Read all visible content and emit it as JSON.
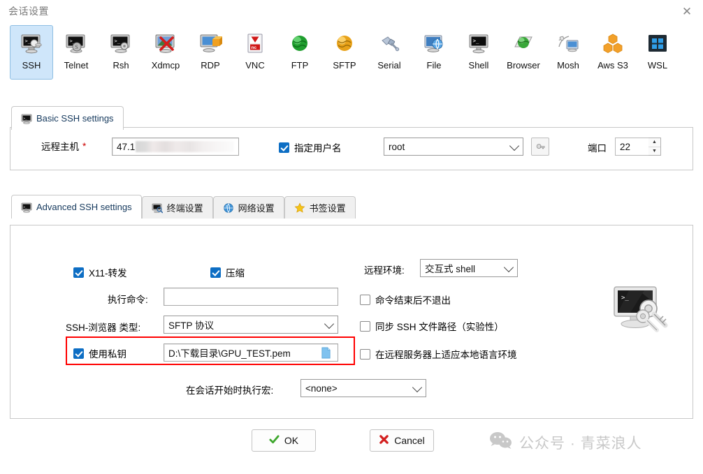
{
  "window": {
    "title": "会话设置",
    "close_label": "✕"
  },
  "protocols": [
    {
      "label": "SSH",
      "icon": "ssh-terminal-icon",
      "selected": true
    },
    {
      "label": "Telnet",
      "icon": "telnet-icon",
      "selected": false
    },
    {
      "label": "Rsh",
      "icon": "rsh-icon",
      "selected": false
    },
    {
      "label": "Xdmcp",
      "icon": "xdmcp-icon",
      "selected": false
    },
    {
      "label": "RDP",
      "icon": "rdp-icon",
      "selected": false
    },
    {
      "label": "VNC",
      "icon": "vnc-icon",
      "selected": false
    },
    {
      "label": "FTP",
      "icon": "ftp-globe-icon",
      "selected": false
    },
    {
      "label": "SFTP",
      "icon": "sftp-globe-icon",
      "selected": false
    },
    {
      "label": "Serial",
      "icon": "serial-plug-icon",
      "selected": false
    },
    {
      "label": "File",
      "icon": "file-share-icon",
      "selected": false
    },
    {
      "label": "Shell",
      "icon": "shell-monitor-icon",
      "selected": false
    },
    {
      "label": "Browser",
      "icon": "browser-globe-icon",
      "selected": false
    },
    {
      "label": "Mosh",
      "icon": "mosh-icon",
      "selected": false
    },
    {
      "label": "Aws S3",
      "icon": "aws-s3-icon",
      "selected": false
    },
    {
      "label": "WSL",
      "icon": "wsl-windows-icon",
      "selected": false
    }
  ],
  "basic": {
    "tab_label": "Basic SSH settings",
    "host_label": "远程主机",
    "host_required_mark": "*",
    "host_value": "47.1",
    "specify_username_label": "指定用户名",
    "specify_username_checked": true,
    "username_value": "root",
    "port_label": "端口",
    "port_value": "22"
  },
  "advanced": {
    "tabs": [
      {
        "label": "Advanced SSH settings",
        "icon": "terminal-icon",
        "active": true
      },
      {
        "label": "终端设置",
        "icon": "terminal-settings-icon",
        "active": false
      },
      {
        "label": "网络设置",
        "icon": "network-globe-icon",
        "active": false
      },
      {
        "label": "书签设置",
        "icon": "star-icon",
        "active": false
      }
    ],
    "x11_forward_label": "X11-转发",
    "x11_forward_checked": true,
    "compression_label": "压缩",
    "compression_checked": true,
    "exec_command_label": "执行命令:",
    "exec_command_value": "",
    "ssh_browser_label": "SSH-浏览器 类型:",
    "ssh_browser_value": "SFTP 协议",
    "use_private_key_label": "使用私钥",
    "use_private_key_checked": true,
    "private_key_path": "D:\\下载目录\\GPU_TEST.pem",
    "remote_env_label": "远程环境:",
    "remote_env_value": "交互式 shell",
    "no_exit_label": "命令结束后不退出",
    "no_exit_checked": false,
    "sync_ssh_path_label": "同步 SSH 文件路径（实验性）",
    "sync_ssh_path_checked": false,
    "adapt_locale_label": "在远程服务器上适应本地语言环境",
    "adapt_locale_checked": false,
    "macro_label": "在会话开始时执行宏:",
    "macro_value": "<none>"
  },
  "footer": {
    "ok_label": "OK",
    "cancel_label": "Cancel"
  },
  "watermark": {
    "text": "公众号 · 青菜浪人"
  },
  "colors": {
    "selected_tab_bg": "#cfe6fa",
    "checkbox_on": "#0d6ec4",
    "highlight_rect": "#ff0000",
    "ok_check": "#3ea72d",
    "cancel_x": "#d32020",
    "watermark": "#c8c8c8"
  }
}
